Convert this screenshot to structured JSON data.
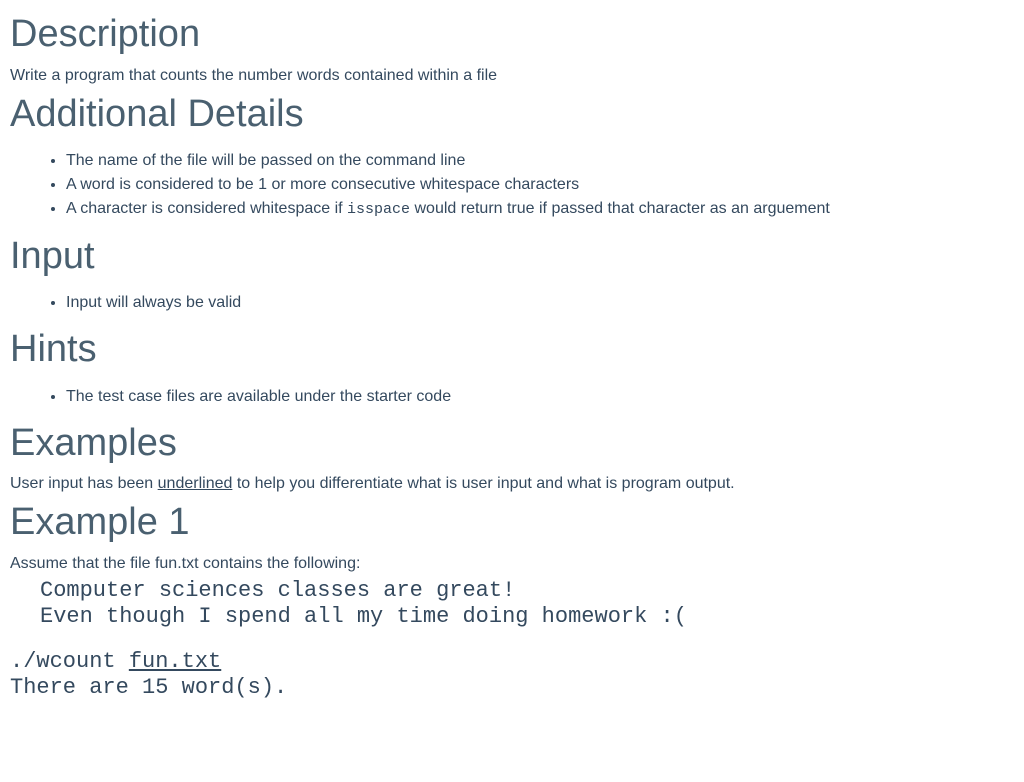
{
  "headings": {
    "description": "Description",
    "additional_details": "Additional Details",
    "input": "Input",
    "hints": "Hints",
    "examples": "Examples",
    "example1": "Example 1"
  },
  "description_text": "Write a program that counts the number words contained within a file",
  "details_items": {
    "item0": "The name of the file will be passed on the command line",
    "item1": "A word is considered to be 1 or more consecutive whitespace characters",
    "item2_before": "A character is considered whitespace if ",
    "item2_code": "isspace",
    "item2_after": " would return true if passed that character as an arguement"
  },
  "input_items": {
    "item0": "Input will always be valid"
  },
  "hints_items": {
    "item0": "The test case files are available under the starter code"
  },
  "examples_intro_before": "User input has been ",
  "examples_intro_underlined": "underlined",
  "examples_intro_after": " to help you differentiate what is user input and what is program output.",
  "example1_assume": "Assume that the file fun.txt contains the following:",
  "example1_file_contents": "Computer sciences classes are great!\nEven though I spend all my time doing homework :(",
  "example1_cmd_prefix": "./wcount ",
  "example1_cmd_input": "fun.txt",
  "example1_output": "There are 15 word(s)."
}
